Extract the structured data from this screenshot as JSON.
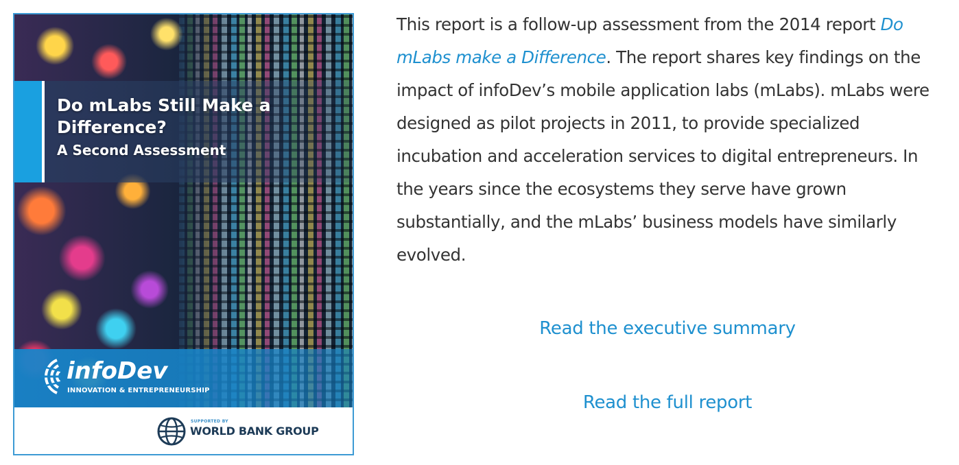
{
  "cover": {
    "title": "Do mLabs Still Make a Difference?",
    "subtitle": "A Second Assessment",
    "brand_name": "infoDev",
    "brand_tagline": "INNOVATION & ENTREPRENEURSHIP",
    "supported_by": "SUPPORTED BY",
    "org_name": "WORLD BANK GROUP",
    "colors": {
      "border": "#3c9ad4",
      "brand_blue": "#1784c9",
      "strip_blue": "#1aa0e0"
    }
  },
  "description": {
    "part1": "This report is a follow-up assessment from the 2014 report ",
    "link_text": "Do mLabs make a Difference",
    "part2": ". The report shares key findings on the impact of infoDev’s mobile application labs (mLabs). mLabs were designed as pilot projects in 2011, to provide specialized incubation and acceleration services to digital entrepreneurs. In the years since the ecosystems they serve have grown substantially, and the mLabs’ business models have similarly evolved."
  },
  "links": {
    "executive_summary": "Read the executive summary",
    "full_report": "Read the full report"
  },
  "colors": {
    "link": "#1e90cf",
    "text": "#333333"
  }
}
